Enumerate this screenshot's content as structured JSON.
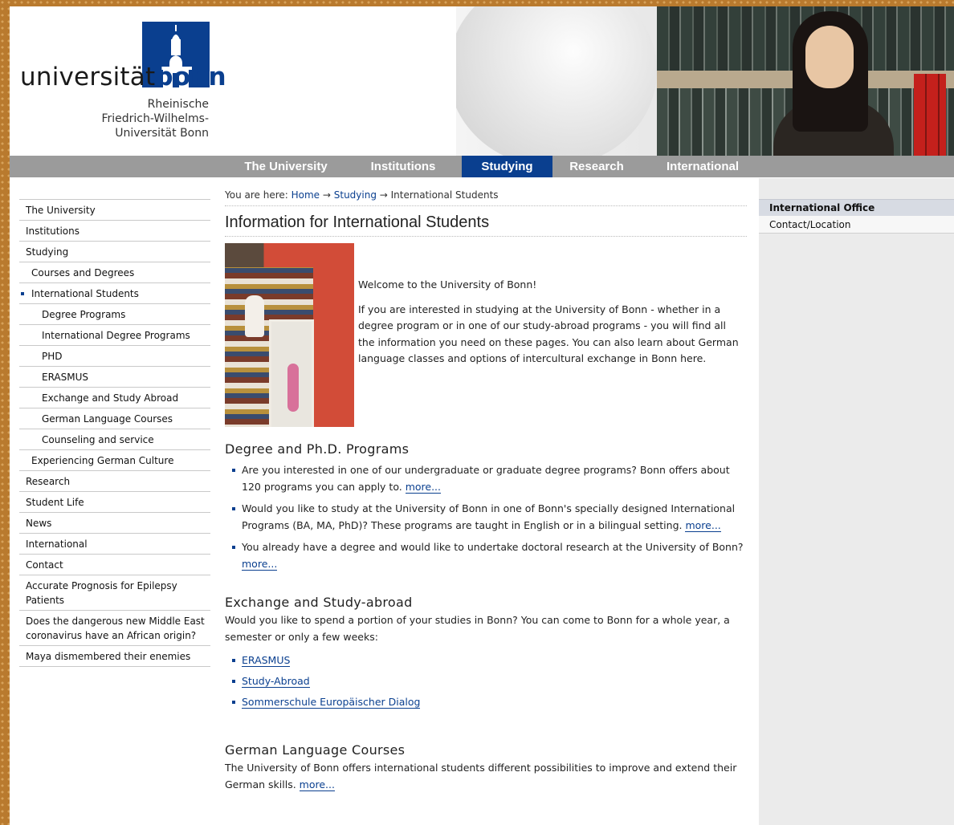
{
  "logo": {
    "word_plain": "universität",
    "word_bold": "bonn",
    "subtitle_line1": "Rheinische",
    "subtitle_line2": "Friedrich-Wilhelms-",
    "subtitle_line3": "Universität Bonn"
  },
  "nav": {
    "items": [
      {
        "label": "The University"
      },
      {
        "label": "Institutions"
      },
      {
        "label": "Studying"
      },
      {
        "label": "Research"
      },
      {
        "label": "International"
      }
    ],
    "active": "Studying"
  },
  "left_menu": {
    "items": [
      {
        "label": "The University"
      },
      {
        "label": "Institutions"
      },
      {
        "label": "Studying"
      },
      {
        "label": "Courses and Degrees"
      },
      {
        "label": "International Students"
      },
      {
        "label": "Degree Programs"
      },
      {
        "label": "International Degree Programs"
      },
      {
        "label": "PHD"
      },
      {
        "label": "ERASMUS"
      },
      {
        "label": "Exchange and Study Abroad"
      },
      {
        "label": "German Language Courses"
      },
      {
        "label": "Counseling and service"
      },
      {
        "label": "Experiencing German Culture"
      },
      {
        "label": "Research"
      },
      {
        "label": "Student Life"
      },
      {
        "label": "News"
      },
      {
        "label": "International"
      },
      {
        "label": "Contact"
      },
      {
        "label": "Accurate Prognosis for Epilepsy Patients"
      },
      {
        "label": "Does the dangerous new Middle East coronavirus have an African origin?"
      },
      {
        "label": "Maya dismembered their enemies"
      }
    ]
  },
  "breadcrumb": {
    "prefix": "You are here: ",
    "home": "Home",
    "sep": " → ",
    "studying": "Studying",
    "current": "International Students"
  },
  "main": {
    "title": "Information for International Students",
    "welcome": "Welcome to the University of Bonn!",
    "intro": "If you are interested in studying at the University of Bonn - whether in a degree program or in one of our study-abroad programs - you will find all the information you need on these pages. You can also learn about German language classes and options of intercultural exchange in Bonn here.",
    "degree_heading": "Degree and Ph.D. Programs",
    "degree_items": [
      {
        "text": "Are you interested in one of our undergraduate or graduate degree programs? Bonn offers about 120 programs you can apply to. ",
        "more": "more..."
      },
      {
        "text": "Would you like to study at the University of Bonn in one of Bonn's specially designed International Programs (BA, MA, PhD)? These programs are taught in English or  in a bilingual setting. ",
        "more": "more..."
      },
      {
        "text": "You already have a degree and would like to undertake doctoral research at the University of Bonn? ",
        "more": "more..."
      }
    ],
    "exchange_heading": "Exchange and Study-abroad",
    "exchange_text": "Would you like to spend a portion of your studies in Bonn? You can come to Bonn for a whole year, a semester or only a few weeks:",
    "exchange_links": [
      "ERASMUS",
      "Study-Abroad",
      "Sommerschule Europäischer Dialog"
    ],
    "german_heading": "German Language Courses",
    "german_text": "The University of Bonn offers international students different possibilities to improve and extend their German skills. ",
    "german_more": "more..."
  },
  "right_sidebar": {
    "heading": "International Office",
    "item": "Contact/Location"
  },
  "colors": {
    "brand_blue": "#0a3f8f",
    "nav_gray": "#9b9b9b",
    "sidebar_gray": "#ebebeb"
  }
}
